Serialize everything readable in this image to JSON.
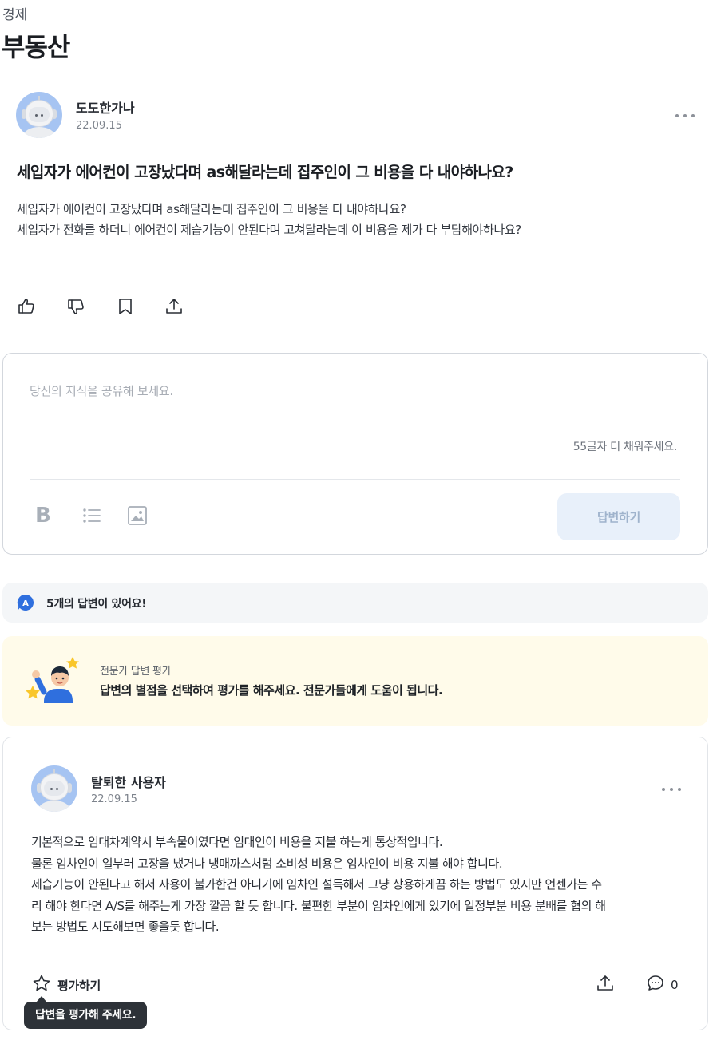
{
  "breadcrumb": "경제",
  "category_title": "부동산",
  "question": {
    "author": "도도한가나",
    "date": "22.09.15",
    "title": "세입자가 에어컨이 고장났다며 as해달라는데 집주인이 그 비용을 다 내야하나요?",
    "body": [
      "세입자가 에어컨이 고장났다며 as해달라는데 집주인이 그 비용을 다 내야하나요?",
      "세입자가 전화를 하더니 에어컨이 제습기능이 안된다며 고쳐달라는데 이 비용을 제가 다 부담해야하나요?"
    ],
    "actions": [
      "like-icon",
      "dislike-icon",
      "bookmark-icon",
      "share-icon"
    ]
  },
  "editor": {
    "placeholder": "당신의 지식을 공유해 보세요.",
    "char_hint": "55글자 더 채워주세요.",
    "tools": [
      "bold-icon",
      "list-icon",
      "image-icon"
    ],
    "submit_label": "답변하기"
  },
  "answers_summary": {
    "badge": "A",
    "text": "5개의 답변이 있어요!"
  },
  "expert_rating": {
    "title": "전문가 답변 평가",
    "description": "답변의 별점을 선택하여 평가를 해주세요. 전문가들에게 도움이 됩니다."
  },
  "answer": {
    "author": "탈퇴한 사용자",
    "date": "22.09.15",
    "body": [
      "기본적으로 임대차계약시 부속물이였다면 임대인이 비용을 지불 하는게 통상적입니다.",
      "물론 임차인이 일부러 고장을 냈거나 냉매까스처럼 소비성 비용은 임차인이 비용 지불 해야 합니다.",
      "제습기능이 안된다고 해서 사용이 불가한건 아니기에 임차인 설득해서 그냥 상용하게끔 하는 방법도 있지만 언젠가는 수",
      "리 해야 한다면 A/S를 해주는게 가장 깔끔 할 듯 합니다. 불편한 부분이 임차인에게 있기에 일정부분 비용 분배를 협의 해",
      "보는 방법도 시도해보면 좋을듯 합니다."
    ],
    "rate_label": "평가하기",
    "comment_count": "0",
    "tooltip": "답변을 평가해 주세요."
  },
  "colors": {
    "accent_blue": "#2f6fde",
    "submit_disabled_bg": "#e8f0fa",
    "expert_bg": "#fffbea",
    "summary_bg": "#f4f6f8",
    "tooltip_bg": "#2d3238"
  }
}
